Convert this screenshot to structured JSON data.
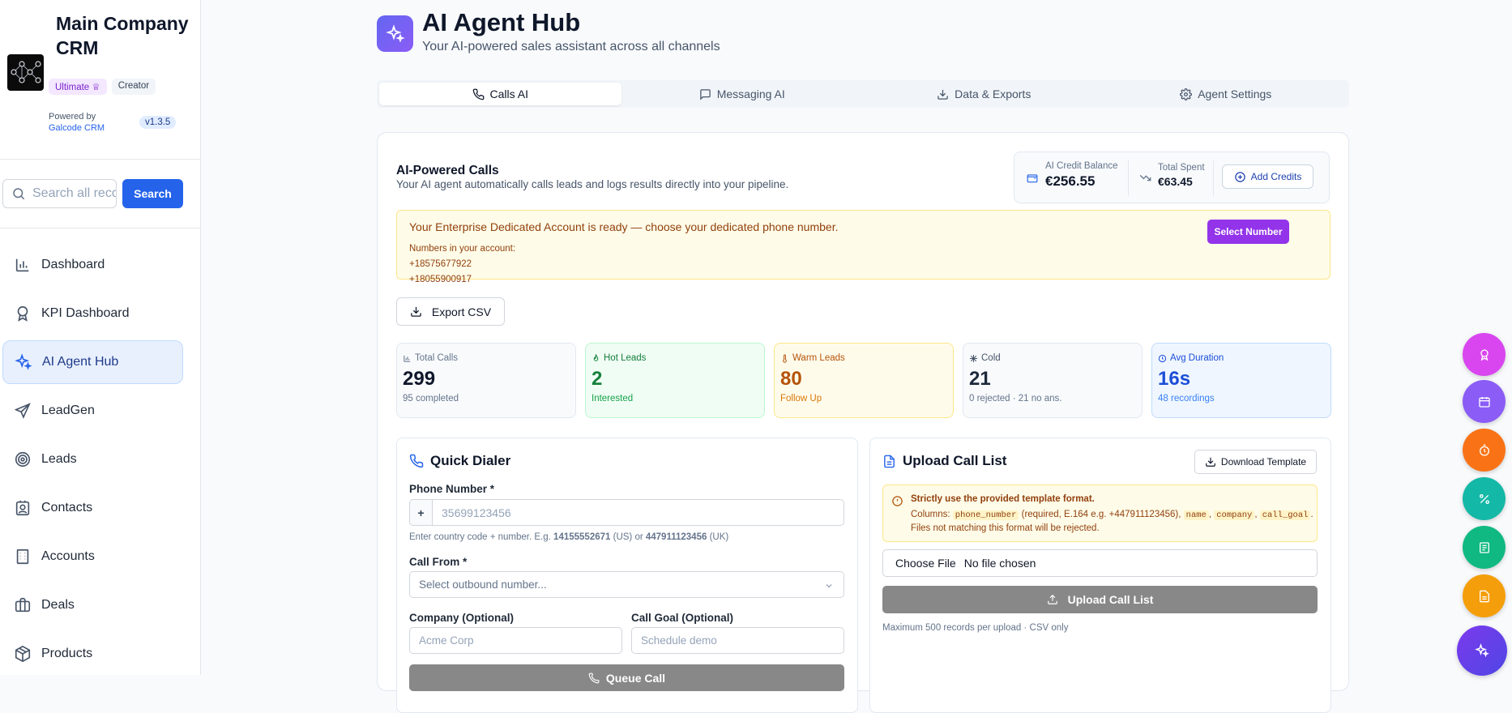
{
  "sidebar": {
    "org_name": "Main Company CRM",
    "plan_badge": "Ultimate",
    "role_badge": "Creator",
    "powered_by": "Powered by",
    "powered_brand": "Galcode CRM",
    "version": "v1.3.5",
    "search_placeholder": "Search all records",
    "search_button": "Search",
    "nav": [
      {
        "label": "Dashboard",
        "icon": "bar-chart-icon"
      },
      {
        "label": "KPI Dashboard",
        "icon": "award-icon"
      },
      {
        "label": "AI Agent Hub",
        "icon": "sparkles-icon",
        "active": true
      },
      {
        "label": "LeadGen",
        "icon": "send-icon"
      },
      {
        "label": "Leads",
        "icon": "target-icon"
      },
      {
        "label": "Contacts",
        "icon": "contact-icon"
      },
      {
        "label": "Accounts",
        "icon": "building-icon"
      },
      {
        "label": "Deals",
        "icon": "briefcase-icon"
      },
      {
        "label": "Products",
        "icon": "package-icon"
      }
    ]
  },
  "header": {
    "title": "AI Agent Hub",
    "subtitle": "Your AI-powered sales assistant across all channels"
  },
  "tabs": [
    {
      "label": "Calls AI",
      "icon": "phone-icon",
      "active": true
    },
    {
      "label": "Messaging AI",
      "icon": "message-icon"
    },
    {
      "label": "Data & Exports",
      "icon": "download-icon"
    },
    {
      "label": "Agent Settings",
      "icon": "gear-icon"
    }
  ],
  "calls": {
    "title": "AI-Powered Calls",
    "subtitle": "Your AI agent automatically calls leads and logs results directly into your pipeline.",
    "credit_label": "AI Credit Balance",
    "credit_value": "€256.55",
    "spent_label": "Total Spent",
    "spent_value": "€63.45",
    "add_credits": "Add Credits",
    "alert_title": "Your Enterprise Dedicated Account is ready — choose your dedicated phone number.",
    "alert_numbers_label": "Numbers in your account:",
    "alert_numbers": [
      "+18575677922",
      "+18055900917"
    ],
    "select_number": "Select Number",
    "export_csv": "Export CSV"
  },
  "stats": [
    {
      "label": "Total Calls",
      "value": "299",
      "sub": "95 completed",
      "icon": "bar-chart-icon"
    },
    {
      "label": "Hot Leads",
      "value": "2",
      "sub": "Interested",
      "icon": "flame-icon"
    },
    {
      "label": "Warm Leads",
      "value": "80",
      "sub": "Follow Up",
      "icon": "thermometer-icon"
    },
    {
      "label": "Cold",
      "value": "21",
      "sub": "0 rejected · 21 no ans.",
      "icon": "snowflake-icon"
    },
    {
      "label": "Avg Duration",
      "value": "16s",
      "sub": "48 recordings",
      "icon": "clock-icon"
    }
  ],
  "dialer": {
    "title": "Quick Dialer",
    "phone_label": "Phone Number *",
    "phone_prefix": "+",
    "phone_placeholder": "35699123456",
    "hint_pre": "Enter country code + number. E.g.",
    "hint_us": "14155552671",
    "hint_mid": "(US) or",
    "hint_uk": "447911123456",
    "hint_post": "(UK)",
    "call_from_label": "Call From *",
    "call_from_placeholder": "Select outbound number...",
    "company_label": "Company (Optional)",
    "company_placeholder": "Acme Corp",
    "goal_label": "Call Goal (Optional)",
    "goal_placeholder": "Schedule demo",
    "queue_button": "Queue Call"
  },
  "upload": {
    "title": "Upload Call List",
    "download_template": "Download Template",
    "warn_title": "Strictly use the provided template format.",
    "warn_columns": "Columns:",
    "col_phone": "phone_number",
    "col_phone_note": "(required, E.164 e.g. +447911123456),",
    "col_name": "name",
    "col_company": "company",
    "col_goal": "call_goal",
    "warn_tail": ". Files not matching this format will be rejected.",
    "choose_file": "Choose File",
    "no_file": "No file chosen",
    "upload_button": "Upload Call List",
    "limit": "Maximum 500 records per upload · CSV only"
  },
  "fabs": [
    {
      "icon": "award-icon",
      "color": "#d946ef"
    },
    {
      "icon": "calendar-icon",
      "color": "#8b5cf6"
    },
    {
      "icon": "timer-icon",
      "color": "#f97316"
    },
    {
      "icon": "percent-icon",
      "color": "#14b8a6"
    },
    {
      "icon": "sheet-icon",
      "color": "#10b981"
    },
    {
      "icon": "note-icon",
      "color": "#f59e0b"
    },
    {
      "icon": "sparkles-icon",
      "color": "#7c3aed"
    }
  ],
  "colors": {
    "primary": "#2563eb",
    "purple": "#9333ea",
    "warning_bg": "#fefce8"
  }
}
